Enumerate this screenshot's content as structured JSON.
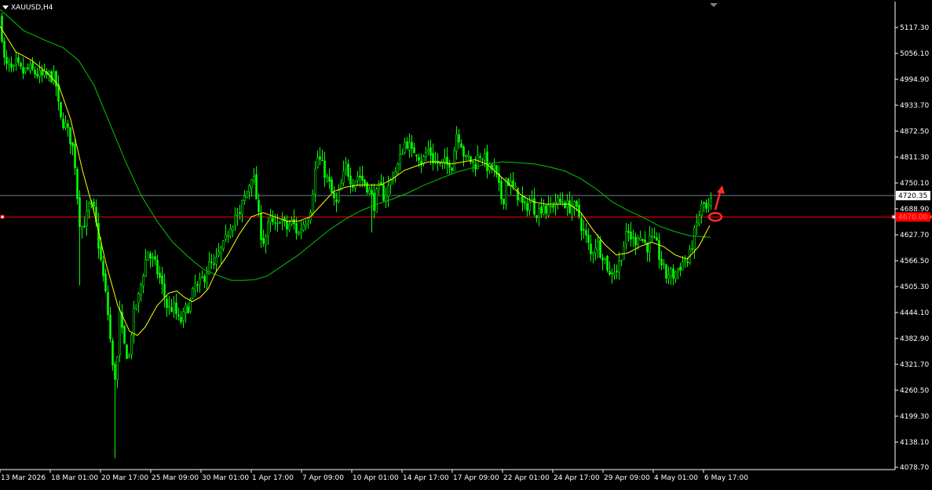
{
  "header": {
    "symbol_timeframe": "XAUUSD,H4"
  },
  "colors": {
    "background": "#000000",
    "candle": "#00ff00",
    "ma_fast": "#ffff00",
    "ma_slow": "#00c800",
    "axis": "#ffffff",
    "level_line": "#ff0000",
    "bid_line": "#708090",
    "annotation": "#ff2a2a"
  },
  "chart_data": {
    "type": "candlestick",
    "symbol": "XAUUSD",
    "timeframe": "H4",
    "ylim": [
      4078.7,
      5178.3
    ],
    "y_ticks": [
      "5117.30",
      "5056.10",
      "4994.90",
      "4933.70",
      "4872.50",
      "4811.30",
      "4750.10",
      "4688.90",
      "4627.70",
      "4566.50",
      "4505.30",
      "4444.10",
      "4382.90",
      "4321.70",
      "4260.50",
      "4199.30",
      "4138.10",
      "4078.70"
    ],
    "x_ticks": [
      "13 Mar 2026",
      "18 Mar 01:00",
      "20 Mar 17:00",
      "25 Mar 09:00",
      "30 Mar 01:00",
      "1 Apr 17:00",
      "7 Apr 09:00",
      "10 Apr 01:00",
      "14 Apr 17:00",
      "17 Apr 09:00",
      "22 Apr 01:00",
      "24 Apr 17:00",
      "29 Apr 09:00",
      "4 May 01:00",
      "6 May 17:00"
    ],
    "current_price": {
      "label": "4720.35",
      "value": 4720.35
    },
    "level_line": {
      "label": "4670.00",
      "value": 4670.0
    },
    "close_path": [
      [
        0,
        5140
      ],
      [
        6,
        5020
      ],
      [
        10,
        5030
      ],
      [
        16,
        5010
      ],
      [
        20,
        5030
      ],
      [
        28,
        5010
      ],
      [
        36,
        5020
      ],
      [
        44,
        5010
      ],
      [
        54,
        5000
      ],
      [
        62,
        5005
      ],
      [
        70,
        4995
      ],
      [
        76,
        4900
      ],
      [
        82,
        4890
      ],
      [
        88,
        4860
      ],
      [
        94,
        4820
      ],
      [
        98,
        4720
      ],
      [
        102,
        4640
      ],
      [
        108,
        4660
      ],
      [
        114,
        4700
      ],
      [
        120,
        4680
      ],
      [
        126,
        4590
      ],
      [
        130,
        4540
      ],
      [
        136,
        4460
      ],
      [
        140,
        4380
      ],
      [
        144,
        4290
      ],
      [
        148,
        4300
      ],
      [
        152,
        4440
      ],
      [
        156,
        4380
      ],
      [
        160,
        4350
      ],
      [
        164,
        4340
      ],
      [
        168,
        4420
      ],
      [
        172,
        4460
      ],
      [
        176,
        4480
      ],
      [
        180,
        4520
      ],
      [
        184,
        4560
      ],
      [
        188,
        4590
      ],
      [
        192,
        4570
      ],
      [
        196,
        4560
      ],
      [
        200,
        4540
      ],
      [
        204,
        4520
      ],
      [
        208,
        4490
      ],
      [
        212,
        4460
      ],
      [
        216,
        4450
      ],
      [
        220,
        4460
      ],
      [
        224,
        4440
      ],
      [
        228,
        4420
      ],
      [
        232,
        4430
      ],
      [
        236,
        4450
      ],
      [
        240,
        4460
      ],
      [
        244,
        4480
      ],
      [
        248,
        4510
      ],
      [
        252,
        4500
      ],
      [
        256,
        4520
      ],
      [
        260,
        4530
      ],
      [
        264,
        4550
      ],
      [
        268,
        4560
      ],
      [
        272,
        4550
      ],
      [
        276,
        4570
      ],
      [
        280,
        4590
      ],
      [
        284,
        4600
      ],
      [
        288,
        4620
      ],
      [
        292,
        4650
      ],
      [
        296,
        4660
      ],
      [
        300,
        4680
      ],
      [
        304,
        4660
      ],
      [
        308,
        4700
      ],
      [
        312,
        4720
      ],
      [
        316,
        4740
      ],
      [
        320,
        4770
      ],
      [
        324,
        4750
      ],
      [
        328,
        4680
      ],
      [
        332,
        4630
      ],
      [
        336,
        4610
      ],
      [
        340,
        4640
      ],
      [
        344,
        4660
      ],
      [
        348,
        4650
      ],
      [
        352,
        4640
      ],
      [
        356,
        4670
      ],
      [
        360,
        4660
      ],
      [
        364,
        4640
      ],
      [
        368,
        4650
      ],
      [
        372,
        4660
      ],
      [
        376,
        4640
      ],
      [
        380,
        4630
      ],
      [
        384,
        4650
      ],
      [
        388,
        4660
      ],
      [
        392,
        4670
      ],
      [
        396,
        4700
      ],
      [
        400,
        4770
      ],
      [
        404,
        4810
      ],
      [
        408,
        4800
      ],
      [
        412,
        4780
      ],
      [
        416,
        4760
      ],
      [
        420,
        4740
      ],
      [
        424,
        4710
      ],
      [
        428,
        4700
      ],
      [
        432,
        4730
      ],
      [
        436,
        4760
      ],
      [
        440,
        4790
      ],
      [
        444,
        4770
      ],
      [
        448,
        4750
      ],
      [
        452,
        4760
      ],
      [
        456,
        4770
      ],
      [
        460,
        4760
      ],
      [
        464,
        4750
      ],
      [
        468,
        4740
      ],
      [
        472,
        4720
      ],
      [
        476,
        4700
      ],
      [
        480,
        4730
      ],
      [
        484,
        4740
      ],
      [
        488,
        4720
      ],
      [
        492,
        4730
      ],
      [
        496,
        4750
      ],
      [
        500,
        4770
      ],
      [
        504,
        4780
      ],
      [
        508,
        4800
      ],
      [
        512,
        4830
      ],
      [
        516,
        4850
      ],
      [
        520,
        4840
      ],
      [
        524,
        4820
      ],
      [
        528,
        4830
      ],
      [
        532,
        4820
      ],
      [
        536,
        4800
      ],
      [
        540,
        4810
      ],
      [
        544,
        4830
      ],
      [
        548,
        4820
      ],
      [
        552,
        4800
      ],
      [
        556,
        4800
      ],
      [
        560,
        4790
      ],
      [
        564,
        4800
      ],
      [
        568,
        4790
      ],
      [
        572,
        4800
      ],
      [
        576,
        4790
      ],
      [
        580,
        4870
      ],
      [
        584,
        4860
      ],
      [
        588,
        4840
      ],
      [
        592,
        4800
      ],
      [
        596,
        4810
      ],
      [
        600,
        4800
      ],
      [
        604,
        4790
      ],
      [
        608,
        4810
      ],
      [
        612,
        4820
      ],
      [
        616,
        4810
      ],
      [
        620,
        4790
      ],
      [
        624,
        4780
      ],
      [
        628,
        4790
      ],
      [
        632,
        4760
      ],
      [
        636,
        4730
      ],
      [
        640,
        4700
      ],
      [
        644,
        4760
      ],
      [
        648,
        4750
      ],
      [
        652,
        4740
      ],
      [
        656,
        4730
      ],
      [
        660,
        4720
      ],
      [
        664,
        4700
      ],
      [
        668,
        4690
      ],
      [
        672,
        4700
      ],
      [
        676,
        4710
      ],
      [
        680,
        4690
      ],
      [
        684,
        4680
      ],
      [
        688,
        4690
      ],
      [
        692,
        4700
      ],
      [
        696,
        4680
      ],
      [
        700,
        4690
      ],
      [
        704,
        4700
      ],
      [
        708,
        4710
      ],
      [
        712,
        4700
      ],
      [
        716,
        4710
      ],
      [
        720,
        4700
      ],
      [
        724,
        4690
      ],
      [
        728,
        4700
      ],
      [
        732,
        4690
      ],
      [
        736,
        4680
      ],
      [
        740,
        4650
      ],
      [
        744,
        4630
      ],
      [
        748,
        4610
      ],
      [
        752,
        4580
      ],
      [
        756,
        4600
      ],
      [
        760,
        4610
      ],
      [
        764,
        4590
      ],
      [
        768,
        4580
      ],
      [
        772,
        4560
      ],
      [
        776,
        4530
      ],
      [
        780,
        4550
      ],
      [
        784,
        4540
      ],
      [
        788,
        4560
      ],
      [
        792,
        4590
      ],
      [
        796,
        4620
      ],
      [
        800,
        4630
      ],
      [
        804,
        4620
      ],
      [
        808,
        4610
      ],
      [
        812,
        4630
      ],
      [
        816,
        4620
      ],
      [
        820,
        4610
      ],
      [
        824,
        4600
      ],
      [
        828,
        4620
      ],
      [
        832,
        4610
      ],
      [
        836,
        4600
      ],
      [
        840,
        4570
      ],
      [
        844,
        4550
      ],
      [
        848,
        4530
      ],
      [
        852,
        4540
      ],
      [
        856,
        4530
      ],
      [
        860,
        4540
      ],
      [
        864,
        4550
      ],
      [
        868,
        4560
      ],
      [
        872,
        4570
      ],
      [
        876,
        4560
      ],
      [
        880,
        4600
      ],
      [
        884,
        4630
      ],
      [
        888,
        4660
      ],
      [
        892,
        4690
      ],
      [
        896,
        4700
      ],
      [
        900,
        4680
      ],
      [
        904,
        4700
      ],
      [
        908,
        4720
      ]
    ],
    "ma_fast": [
      [
        0,
        5120
      ],
      [
        20,
        5060
      ],
      [
        40,
        5040
      ],
      [
        60,
        5010
      ],
      [
        75,
        4980
      ],
      [
        90,
        4900
      ],
      [
        105,
        4780
      ],
      [
        120,
        4680
      ],
      [
        135,
        4560
      ],
      [
        150,
        4460
      ],
      [
        165,
        4400
      ],
      [
        175,
        4390
      ],
      [
        185,
        4410
      ],
      [
        200,
        4460
      ],
      [
        215,
        4490
      ],
      [
        225,
        4495
      ],
      [
        235,
        4480
      ],
      [
        245,
        4470
      ],
      [
        255,
        4480
      ],
      [
        265,
        4500
      ],
      [
        275,
        4540
      ],
      [
        290,
        4580
      ],
      [
        305,
        4630
      ],
      [
        320,
        4670
      ],
      [
        335,
        4680
      ],
      [
        350,
        4670
      ],
      [
        365,
        4660
      ],
      [
        380,
        4660
      ],
      [
        395,
        4670
      ],
      [
        410,
        4700
      ],
      [
        425,
        4730
      ],
      [
        440,
        4740
      ],
      [
        455,
        4745
      ],
      [
        470,
        4745
      ],
      [
        485,
        4745
      ],
      [
        500,
        4760
      ],
      [
        515,
        4780
      ],
      [
        530,
        4790
      ],
      [
        545,
        4800
      ],
      [
        560,
        4800
      ],
      [
        575,
        4795
      ],
      [
        590,
        4800
      ],
      [
        605,
        4805
      ],
      [
        620,
        4795
      ],
      [
        635,
        4770
      ],
      [
        650,
        4745
      ],
      [
        665,
        4720
      ],
      [
        680,
        4705
      ],
      [
        695,
        4700
      ],
      [
        710,
        4700
      ],
      [
        725,
        4700
      ],
      [
        740,
        4680
      ],
      [
        755,
        4640
      ],
      [
        770,
        4605
      ],
      [
        785,
        4580
      ],
      [
        800,
        4585
      ],
      [
        815,
        4600
      ],
      [
        830,
        4610
      ],
      [
        845,
        4600
      ],
      [
        860,
        4580
      ],
      [
        875,
        4570
      ],
      [
        890,
        4600
      ],
      [
        904,
        4650
      ]
    ],
    "ma_slow": [
      [
        0,
        5160
      ],
      [
        30,
        5110
      ],
      [
        60,
        5085
      ],
      [
        80,
        5070
      ],
      [
        100,
        5040
      ],
      [
        120,
        4980
      ],
      [
        140,
        4890
      ],
      [
        160,
        4800
      ],
      [
        180,
        4720
      ],
      [
        200,
        4660
      ],
      [
        220,
        4610
      ],
      [
        240,
        4575
      ],
      [
        260,
        4545
      ],
      [
        280,
        4530
      ],
      [
        295,
        4520
      ],
      [
        310,
        4520
      ],
      [
        325,
        4522
      ],
      [
        340,
        4530
      ],
      [
        360,
        4555
      ],
      [
        380,
        4580
      ],
      [
        400,
        4610
      ],
      [
        420,
        4640
      ],
      [
        440,
        4665
      ],
      [
        460,
        4685
      ],
      [
        480,
        4700
      ],
      [
        500,
        4712
      ],
      [
        520,
        4727
      ],
      [
        540,
        4745
      ],
      [
        560,
        4760
      ],
      [
        580,
        4775
      ],
      [
        600,
        4785
      ],
      [
        620,
        4795
      ],
      [
        640,
        4800
      ],
      [
        660,
        4798
      ],
      [
        680,
        4795
      ],
      [
        700,
        4788
      ],
      [
        720,
        4778
      ],
      [
        740,
        4760
      ],
      [
        760,
        4735
      ],
      [
        780,
        4705
      ],
      [
        800,
        4685
      ],
      [
        820,
        4668
      ],
      [
        840,
        4648
      ],
      [
        860,
        4635
      ],
      [
        880,
        4625
      ],
      [
        905,
        4622
      ]
    ]
  },
  "annotations": [
    {
      "type": "circle",
      "near_price": 4670.0
    },
    {
      "type": "arrow",
      "direction": "up"
    }
  ]
}
